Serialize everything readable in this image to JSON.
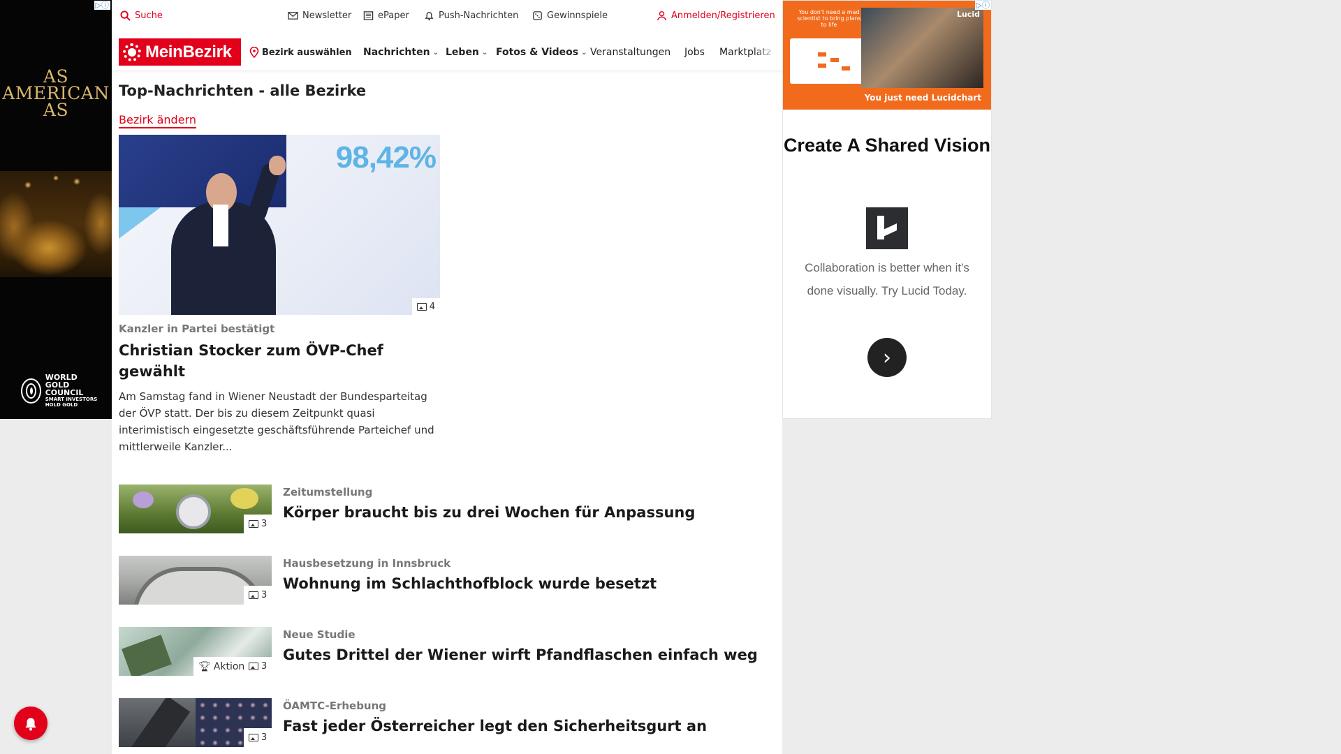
{
  "left_ad": {
    "adchoices": "▷ⓘ",
    "headline": "AS AMERICAN AS",
    "brand_line1": "WORLD",
    "brand_line2": "GOLD",
    "brand_line3": "COUNCIL",
    "brand_tagline": "SMART INVESTORS HOLD GOLD"
  },
  "topbar": {
    "search": "Suche",
    "newsletter": "Newsletter",
    "epaper": "ePaper",
    "push": "Push-Nachrichten",
    "contests": "Gewinnspiele",
    "login": "Anmelden/Registrieren"
  },
  "nav": {
    "logo": "MeinBezirk",
    "select_district": "Bezirk auswählen",
    "items": [
      "Nachrichten",
      "Leben",
      "Fotos & Videos",
      "Veranstaltungen",
      "Jobs",
      "Marktplatz"
    ]
  },
  "page": {
    "title": "Top-Nachrichten - alle Bezirke",
    "change_district": "Bezirk ändern"
  },
  "hero": {
    "image_text": "98,42%",
    "image_count": "4",
    "kicker": "Kanzler in Partei bestätigt",
    "title": "Christian Stocker zum ÖVP-Chef gewählt",
    "teaser": "Am Samstag fand in Wiener Neustadt der Bundesparteitag der ÖVP statt. Der bis zu diesem Zeitpunkt quasi interimistisch eingesetzte geschäftsführende Parteichef und mittlerweile Kanzler..."
  },
  "articles": [
    {
      "kicker": "Zeitumstellung",
      "title": "Körper braucht bis zu drei Wochen für Anpassung",
      "image_count": "3"
    },
    {
      "kicker": "Hausbesetzung in Innsbruck",
      "title": "Wohnung im Schlachthofblock wurde besetzt",
      "image_count": "3"
    },
    {
      "kicker": "Neue Studie",
      "title": "Gutes Drittel der Wiener wirft Pfandflaschen einfach weg",
      "image_count": "3",
      "badge": "Aktion"
    },
    {
      "kicker": "ÖAMTC-Erhebung",
      "title": "Fast jeder Österreicher legt den Sicherheitsgurt an",
      "image_count": "3"
    }
  ],
  "right_ad": {
    "adchoices": "▷ⓘ",
    "banner_small": "You don't need a mad scientist to bring plans to life",
    "banner_brand": "Lucid",
    "banner_tagline": "You just need Lucidchart",
    "headline": "Create A Shared Vision",
    "copy": "Collaboration is better when it's done visually. Try Lucid Today.",
    "cta": "›"
  },
  "colors": {
    "brand_red": "#e2001a",
    "lucid_orange": "#f26b1d",
    "gold": "#d9b86a"
  }
}
